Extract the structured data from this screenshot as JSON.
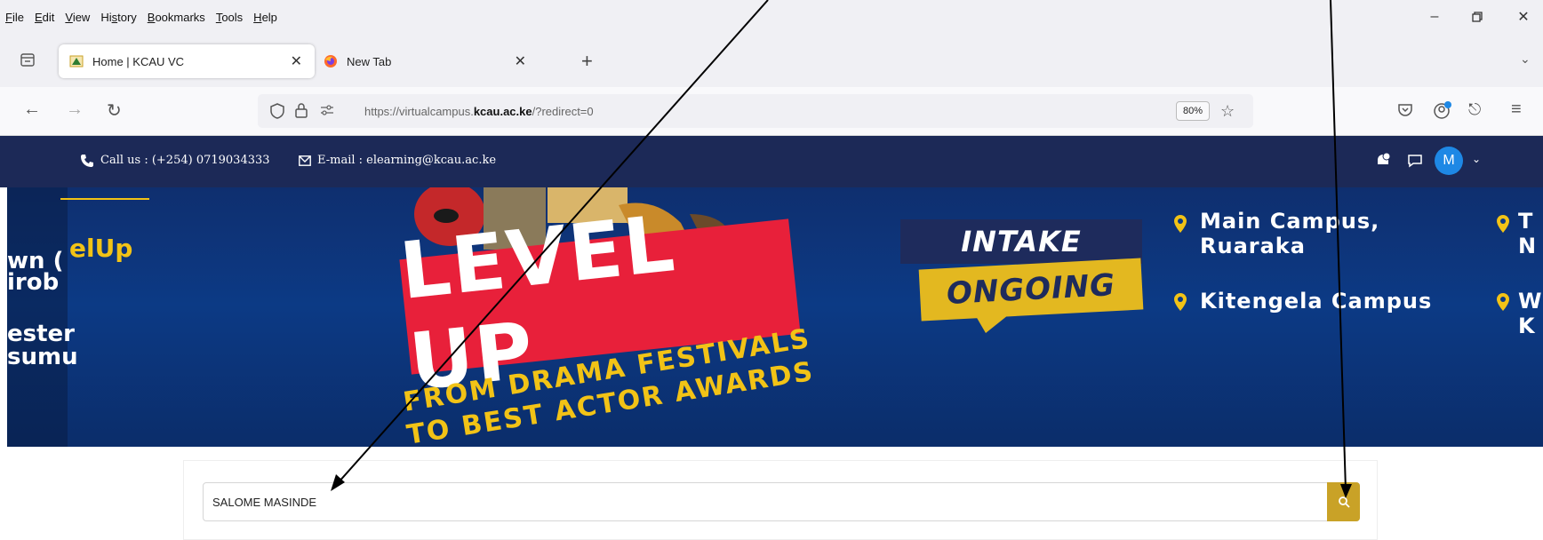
{
  "menu": {
    "items": [
      {
        "accel": "F",
        "rest": "ile"
      },
      {
        "accel": "E",
        "rest": "dit"
      },
      {
        "accel": "V",
        "rest": "iew"
      },
      {
        "pre": "Hi",
        "accel": "s",
        "rest": "tory"
      },
      {
        "accel": "B",
        "rest": "ookmarks"
      },
      {
        "accel": "T",
        "rest": "ools"
      },
      {
        "accel": "H",
        "rest": "elp"
      }
    ]
  },
  "tabs": [
    {
      "label": "Home | KCAU VC",
      "active": true,
      "icon": "kcau-favicon"
    },
    {
      "label": "New Tab",
      "active": false,
      "icon": "firefox-icon"
    }
  ],
  "nav": {
    "url_prefix": "https://virtualcampus.",
    "url_domain": "kcau.ac.ke",
    "url_suffix": "/?redirect=0",
    "zoom": "80%"
  },
  "site": {
    "call_text": "Call us : (+254) 0719034333",
    "email_text": "E-mail : elearning@kcau.ac.ke",
    "avatar_initial": "M"
  },
  "banner": {
    "left_lines": [
      "wn (",
      "irob",
      "ester",
      "sumu"
    ],
    "levelup_tag": "elUp",
    "levelup": "LEVEL UP",
    "drama_line1": "FROM DRAMA FESTIVALS",
    "drama_line2": "TO BEST ACTOR AWARDS",
    "intake": "INTAKE",
    "ongoing": "ONGOING",
    "campus_main_1": "Main Campus,",
    "campus_main_2": "Ruaraka",
    "campus_kitengela": "Kitengela Campus",
    "campus_right_1a": "T",
    "campus_right_1b": "N",
    "campus_right_2a": "W",
    "campus_right_2b": "K"
  },
  "search": {
    "value": "SALOME MASINDE"
  },
  "colors": {
    "navy": "#1c2957",
    "banner_blue": "#0c3a85",
    "gold": "#c9a227",
    "red": "#e8203a"
  }
}
